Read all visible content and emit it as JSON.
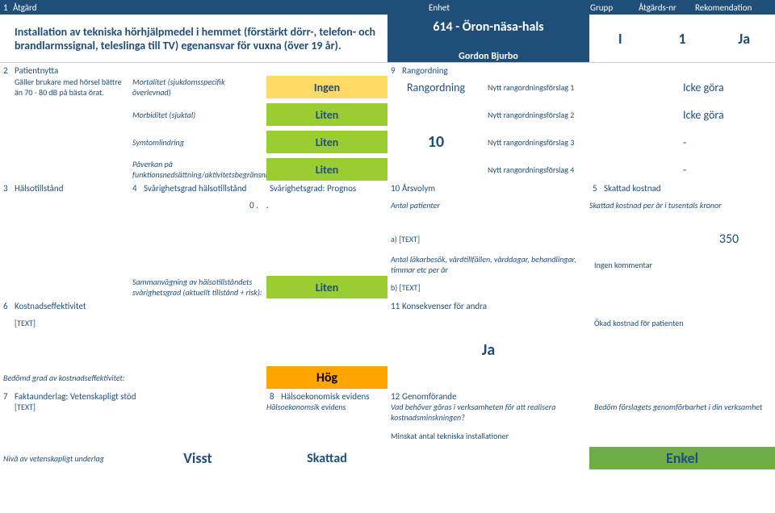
{
  "header": {
    "c1": "1",
    "c2": "Åtgärd",
    "c3": "Enhet",
    "c4": "Grupp",
    "c5": "Åtgärds-nr",
    "c6": "Rekomendation"
  },
  "title_row": {
    "action": "Installation av tekniska hörhjälpmedel i hemmet (förstärkt dörr-, telefon- och brandlarmssignal, teleslinga till TV) egenansvar för vuxna (över 19 år).",
    "unit": "614 - Öron-näsa-hals",
    "unit_sub": "Gordon Bjurbo",
    "group": "I",
    "action_nr": "1",
    "rec": "Ja"
  },
  "section2": {
    "num": "2",
    "label": "Patientnytta",
    "sub": "Gäller brukare med hörsel bättre än 70 - 80 dB på bästa örat."
  },
  "section9": {
    "num": "9",
    "label": "Rangordning"
  },
  "m1": {
    "label": "Mortalitet (sjukdomsspecifik överlevnad)",
    "val": "Ingen",
    "rlabel": "Rangordning",
    "pl": "Nytt rangordningsförslag 1",
    "pv": "Icke göra"
  },
  "m2": {
    "label": "Morbiditet (sjuktal)",
    "val": "Liten",
    "pl": "Nytt rangordningsförslag 2",
    "pv": "Icke göra"
  },
  "m3": {
    "label": "Symtomlindring",
    "val": "Liten",
    "rv": "10",
    "pl": "Nytt rangordningsförslag 3",
    "pv": "-"
  },
  "m4": {
    "label": "Påverkan på funktionsnedsättning/aktivitetsbegränsning",
    "val": "Liten",
    "pl": "Nytt rangordningsförslag 4",
    "pv": "-"
  },
  "section3": {
    "num": "3",
    "label": "Hälsotillstånd"
  },
  "section4": {
    "num": "4",
    "label": "Svårighetsgrad hälsotillstånd",
    "val": "0 ."
  },
  "section4b": {
    "label": "Svårighetsgrad: Prognos",
    "val": "."
  },
  "section10": {
    "num": "10",
    "label": "Årsvolym",
    "sub": "Antal patienter"
  },
  "section5": {
    "num": "5",
    "label": "Skattad kostnad",
    "sub": "Skattad kostnad per år i tusentals kronor"
  },
  "a_row": {
    "label": "a) [TEXT]",
    "val": "350"
  },
  "b_row": {
    "label_mid": "Antal läkarbesök, vårdtillfällen, vårddagar, behandlingar, timmar etc per år",
    "right": "Ingen kommentar"
  },
  "sv": {
    "label": "Sammanvägning av hälsotillståndets svårighetsgrad (aktuellt tillstånd + risk):",
    "val": "Liten",
    "blabel": "b) [TEXT]"
  },
  "section6": {
    "num": "6",
    "label": "Kostnadseffektivitet",
    "sub": "[TEXT]"
  },
  "section11": {
    "num": "11",
    "label": "Konsekvenser för andra",
    "right": "Ökad kostnad för patienten",
    "val": "Ja"
  },
  "bedomd": {
    "label": "Bedömd grad av kostnadseffektivitet:",
    "val": "Hög"
  },
  "section7": {
    "num": "7",
    "label": "Faktaunderlag: Vetenskapligt stöd",
    "sub": "[TEXT]"
  },
  "section8": {
    "num": "8",
    "label": "Hälsoekonomisk evidens",
    "sub": "Hälsoekonomsik evidens"
  },
  "section12": {
    "num": "12",
    "label": "Genomförande",
    "sub": "Vad behöver göras i verksamheten för att realisera kostnadsminskningen?",
    "sub2": "Minskat antal tekniska installationer",
    "right": "Bedöm förslagets genomförbarhet i din verksamhet"
  },
  "bottom": {
    "v1_label": "Nivå av vetenskapligt underlag",
    "v1": "Visst",
    "v2": "Skattad",
    "v3": "Enkel"
  }
}
